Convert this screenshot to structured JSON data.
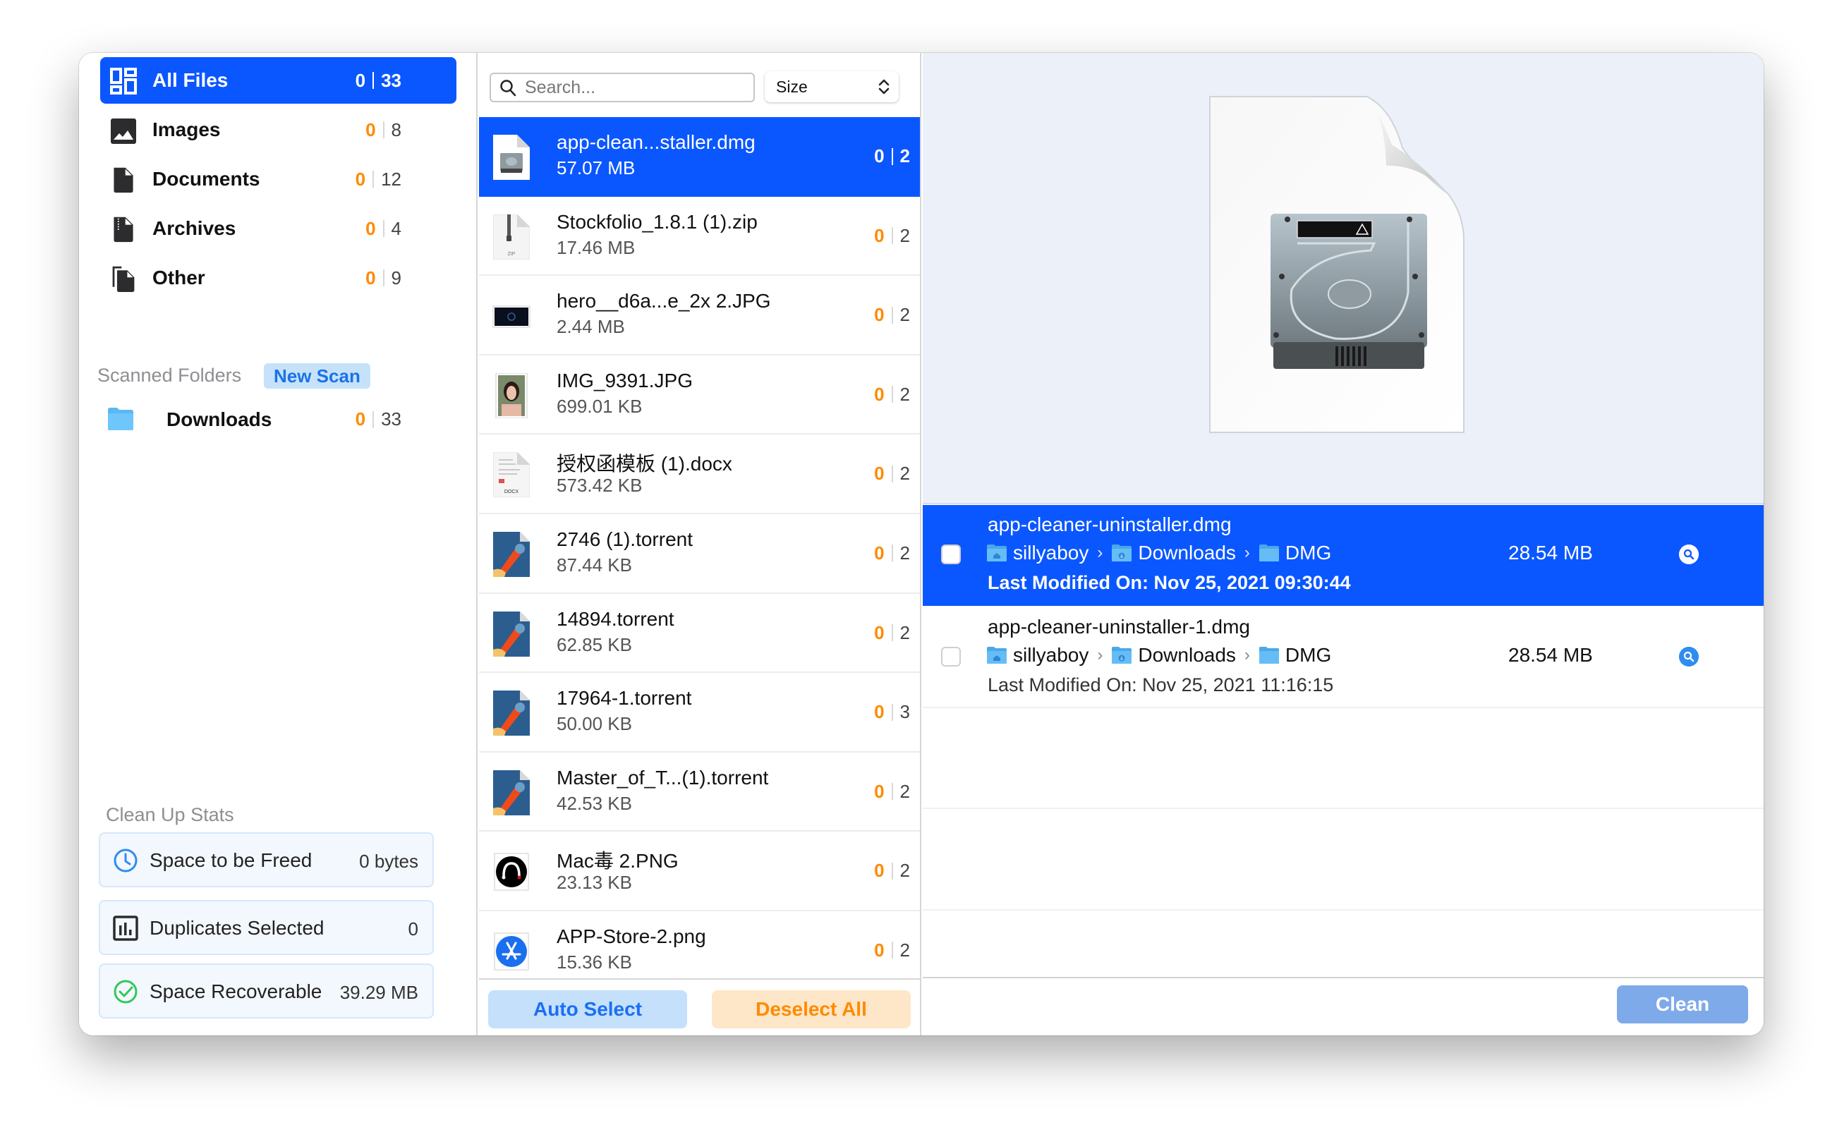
{
  "window": {
    "traffic_lights": [
      "close",
      "minimize",
      "zoom"
    ]
  },
  "sidebar": {
    "categories": [
      {
        "label": "All Files",
        "icon": "grid-icon",
        "selected": "0",
        "total": "33",
        "active": true
      },
      {
        "label": "Images",
        "icon": "image-icon",
        "selected": "0",
        "total": "8",
        "active": false
      },
      {
        "label": "Documents",
        "icon": "document-icon",
        "selected": "0",
        "total": "12",
        "active": false
      },
      {
        "label": "Archives",
        "icon": "archive-icon",
        "selected": "0",
        "total": "4",
        "active": false
      },
      {
        "label": "Other",
        "icon": "other-files-icon",
        "selected": "0",
        "total": "9",
        "active": false
      }
    ],
    "scanned_folders_label": "Scanned Folders",
    "new_scan_label": "New Scan",
    "folders": [
      {
        "label": "Downloads",
        "selected": "0",
        "total": "33"
      }
    ],
    "stats_label": "Clean Up Stats",
    "stats": [
      {
        "label": "Space to be Freed",
        "value": "0 bytes",
        "icon": "clock-icon"
      },
      {
        "label": "Duplicates Selected",
        "value": "0",
        "icon": "bar-chart-icon"
      },
      {
        "label": "Space Recoverable",
        "value": "39.29 MB",
        "icon": "check-circle-icon"
      }
    ]
  },
  "middle": {
    "search_placeholder": "Search...",
    "search_value": "",
    "sort_value": "Size",
    "files": [
      {
        "name": "app-clean...staller.dmg",
        "size": "57.07 MB",
        "selected": "0",
        "total": "2",
        "type": "dmg",
        "active": true
      },
      {
        "name": "Stockfolio_1.8.1 (1).zip",
        "size": "17.46 MB",
        "selected": "0",
        "total": "2",
        "type": "zip"
      },
      {
        "name": "hero__d6a...e_2x 2.JPG",
        "size": "2.44 MB",
        "selected": "0",
        "total": "2",
        "type": "jpg-dark"
      },
      {
        "name": "IMG_9391.JPG",
        "size": "699.01 KB",
        "selected": "0",
        "total": "2",
        "type": "jpg-photo"
      },
      {
        "name": "授权函模板 (1).docx",
        "size": "573.42 KB",
        "selected": "0",
        "total": "2",
        "type": "docx"
      },
      {
        "name": "2746 (1).torrent",
        "size": "87.44 KB",
        "selected": "0",
        "total": "2",
        "type": "torrent"
      },
      {
        "name": "14894.torrent",
        "size": "62.85 KB",
        "selected": "0",
        "total": "2",
        "type": "torrent"
      },
      {
        "name": "17964-1.torrent",
        "size": "50.00 KB",
        "selected": "0",
        "total": "3",
        "type": "torrent"
      },
      {
        "name": "Master_of_T...(1).torrent",
        "size": "42.53 KB",
        "selected": "0",
        "total": "2",
        "type": "torrent"
      },
      {
        "name": "Mac毒 2.PNG",
        "size": "23.13 KB",
        "selected": "0",
        "total": "2",
        "type": "png-dark"
      },
      {
        "name": "APP-Store-2.png",
        "size": "15.36 KB",
        "selected": "0",
        "total": "2",
        "type": "png-appstore"
      }
    ],
    "auto_select_label": "Auto Select",
    "deselect_all_label": "Deselect All"
  },
  "right": {
    "preview_icon": "dmg-disk-icon",
    "duplicates": [
      {
        "name": "app-cleaner-uninstaller.dmg",
        "path": [
          "sillyaboy",
          "Downloads",
          "DMG"
        ],
        "size": "28.54 MB",
        "modified": "Last Modified On: Nov 25, 2021 09:30:44",
        "checked": false,
        "active": true
      },
      {
        "name": "app-cleaner-uninstaller-1.dmg",
        "path": [
          "sillyaboy",
          "Downloads",
          "DMG"
        ],
        "size": "28.54 MB",
        "modified": "Last Modified On: Nov 25, 2021 11:16:15",
        "checked": false,
        "active": false
      }
    ],
    "clean_label": "Clean"
  },
  "colors": {
    "accent": "#0b57ff",
    "selected_count": "#ff8a00",
    "preview_bg": "#ecf0f8",
    "clean_button": "#7eaaea"
  }
}
